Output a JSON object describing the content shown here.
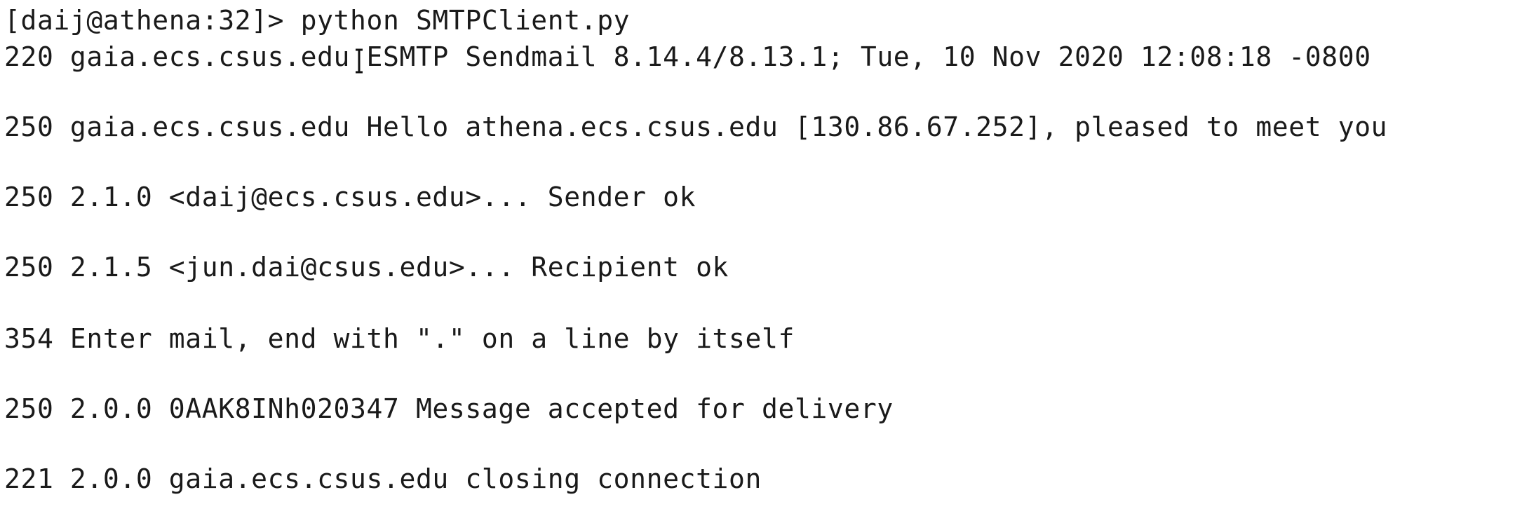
{
  "terminal": {
    "prompt_line": "[daij@athena:32]> python SMTPClient.py",
    "lines": [
      "220 gaia.ecs.csus.edu ESMTP Sendmail 8.14.4/8.13.1; Tue, 10 Nov 2020 12:08:18 -0800",
      "250 gaia.ecs.csus.edu Hello athena.ecs.csus.edu [130.86.67.252], pleased to meet you",
      "250 2.1.0 <daij@ecs.csus.edu>... Sender ok",
      "250 2.1.5 <jun.dai@csus.edu>... Recipient ok",
      "354 Enter mail, end with \".\" on a line by itself",
      "250 2.0.0 0AAK8INh020347 Message accepted for delivery",
      "221 2.0.0 gaia.ecs.csus.edu closing connection"
    ]
  },
  "icons": {
    "cursor": "text-cursor-icon"
  }
}
